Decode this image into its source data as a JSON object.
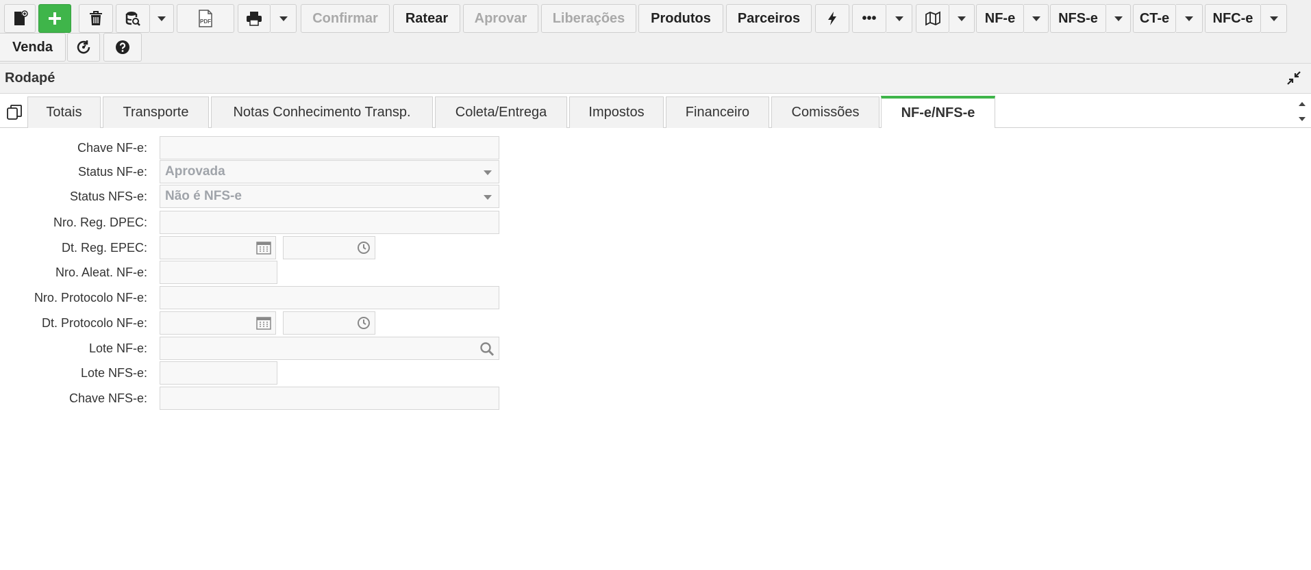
{
  "toolbar": {
    "confirmar": "Confirmar",
    "ratear": "Ratear",
    "aprovar": "Aprovar",
    "liberacoes": "Liberações",
    "produtos": "Produtos",
    "parceiros": "Parceiros",
    "more": "•••",
    "nfe": "NF-e",
    "nfse": "NFS-e",
    "cte": "CT-e",
    "nfce": "NFC-e",
    "venda": "Venda",
    "pdf_icon_text": "PDF"
  },
  "section": {
    "title": "Rodapé"
  },
  "tabs": [
    {
      "label": "Totais"
    },
    {
      "label": "Transporte"
    },
    {
      "label": "Notas Conhecimento Transp."
    },
    {
      "label": "Coleta/Entrega"
    },
    {
      "label": "Impostos"
    },
    {
      "label": "Financeiro"
    },
    {
      "label": "Comissões"
    },
    {
      "label": "NF-e/NFS-e"
    }
  ],
  "form": {
    "chave_nfe": {
      "label": "Chave NF-e:",
      "value": ""
    },
    "status_nfe": {
      "label": "Status NF-e:",
      "value": "Aprovada"
    },
    "status_nfse": {
      "label": "Status NFS-e:",
      "value": "Não é NFS-e"
    },
    "nro_reg_dpec": {
      "label": "Nro. Reg. DPEC:",
      "value": ""
    },
    "dt_reg_epec": {
      "label": "Dt. Reg. EPEC:",
      "date": "",
      "time": ""
    },
    "nro_aleat_nfe": {
      "label": "Nro. Aleat. NF-e:",
      "value": ""
    },
    "nro_protocolo_nfe": {
      "label": "Nro. Protocolo NF-e:",
      "value": ""
    },
    "dt_protocolo_nfe": {
      "label": "Dt. Protocolo NF-e:",
      "date": "",
      "time": ""
    },
    "lote_nfe": {
      "label": "Lote NF-e:",
      "value": ""
    },
    "lote_nfse": {
      "label": "Lote NFS-e:",
      "value": ""
    },
    "chave_nfse": {
      "label": "Chave NFS-e:",
      "value": ""
    }
  },
  "colors": {
    "accent": "#3fb54a",
    "disabled_text": "#a9a9a9"
  }
}
